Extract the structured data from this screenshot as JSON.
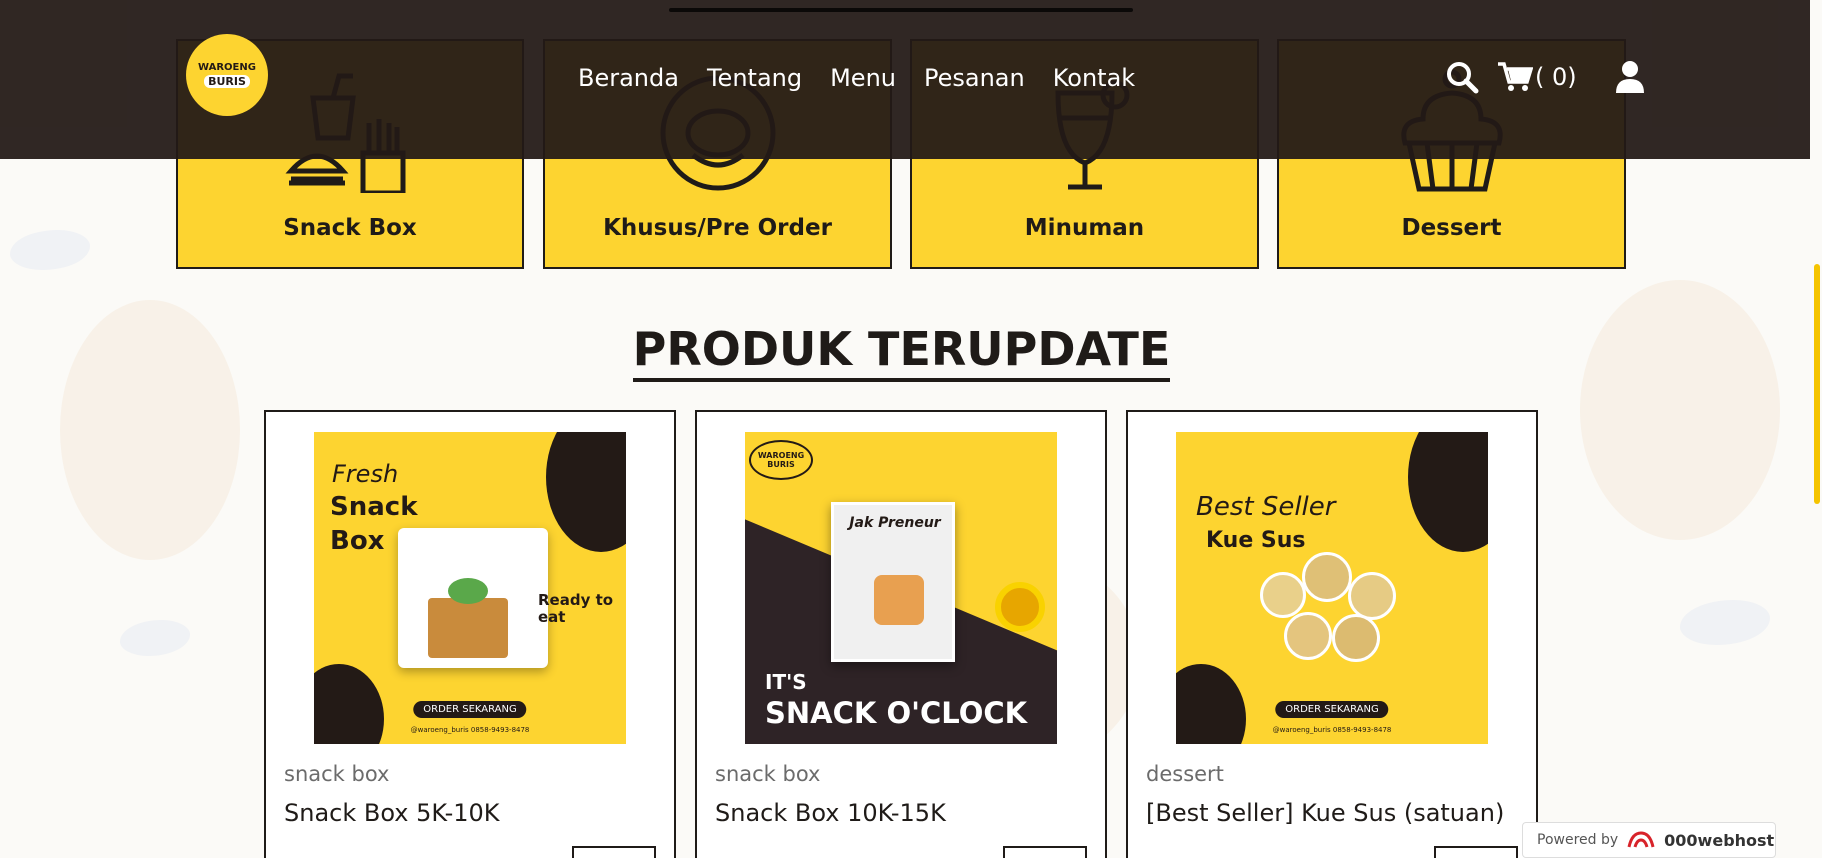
{
  "header": {
    "logo_line1": "WAROENG",
    "logo_line2": "BURIS",
    "nav": [
      "Beranda",
      "Tentang",
      "Menu",
      "Pesanan",
      "Kontak"
    ],
    "cart_count": "( 0)"
  },
  "categories": [
    {
      "label": "Snack Box",
      "icon": "burger-drink-fries-icon"
    },
    {
      "label": "Khusus/Pre Order",
      "icon": "rice-plate-icon"
    },
    {
      "label": "Minuman",
      "icon": "cocktail-glass-icon"
    },
    {
      "label": "Dessert",
      "icon": "cupcake-icon"
    }
  ],
  "section_title": "PRODUK TERUPDATE",
  "products": [
    {
      "category": "snack box",
      "name": "Snack Box 5K-10K",
      "image": {
        "line1": "Fresh",
        "line2": "Snack",
        "line3": "Box",
        "side": "Ready to eat",
        "order": "ORDER SEKARANG",
        "footer": "@waroeng_buris   0858-9493-8478"
      }
    },
    {
      "category": "snack box",
      "name": "Snack Box 10K-15K",
      "image": {
        "logo1": "WAROENG",
        "logo2": "BURIS",
        "brand": "Jak Preneur",
        "line1": "IT'S",
        "line2": "SNACK O'CLOCK"
      }
    },
    {
      "category": "dessert",
      "name": "[Best Seller] Kue Sus (satuan)",
      "image": {
        "line1": "Best Seller",
        "line2": "Kue Sus",
        "order": "ORDER SEKARANG",
        "footer": "@waroeng_buris   0858-9493-8478"
      }
    }
  ],
  "powered": {
    "by": "Powered by",
    "brand": "000webhost"
  },
  "colors": {
    "accent": "#fdd430",
    "dark": "#231a16"
  }
}
